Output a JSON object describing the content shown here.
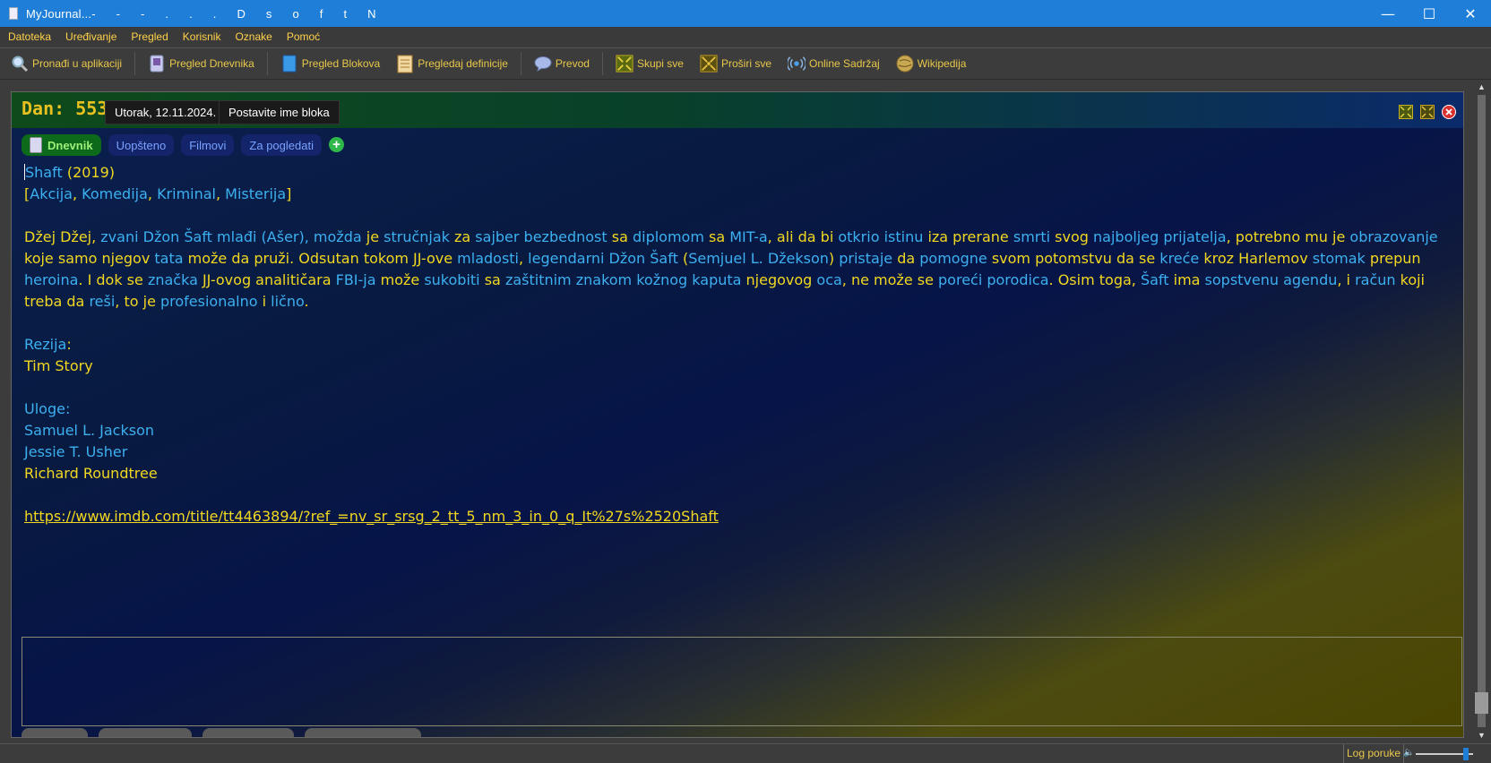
{
  "window": {
    "title": "MyJournal...-      -      -      .      .      .      D      s      o      f      t      N",
    "minimize_glyph": "—",
    "maximize_glyph": "☐",
    "close_glyph": "✕"
  },
  "menu": [
    "Datoteka",
    "Uređivanje",
    "Pregled",
    "Korisnik",
    "Oznake",
    "Pomoć"
  ],
  "toolbar": {
    "find": "Pronađi u aplikaciji",
    "journal": "Pregled Dnevnika",
    "blocks": "Pregled Blokova",
    "definitions": "Pregledaj definicije",
    "translate": "Prevod",
    "collapse": "Skupi sve",
    "expand": "Proširi sve",
    "online": "Online Sadržaj",
    "wiki": "Wikipedija"
  },
  "panel": {
    "day": "Dan: 553",
    "date": "Utorak, 12.11.2024.",
    "block_name_button": "Postavite ime bloka"
  },
  "tabs": {
    "journal": "Dnevnik",
    "general": "Uopšteno",
    "movies": "Filmovi",
    "watchlist": "Za pogledati",
    "add": "+"
  },
  "entry": {
    "title_word": "Shaft",
    "year": "(2019)",
    "genres_open": "[",
    "genre1": "Akcija",
    "genre2": "Komedija",
    "genre3": "Kriminal",
    "genre4": "Misterija",
    "genres_close": "]",
    "comma": ", ",
    "description_parts": [
      [
        "y",
        "Džej Džej, "
      ],
      [
        "b",
        "zvani Džon Šaft mlađi (Ašer), "
      ],
      [
        "b",
        "možda "
      ],
      [
        "y",
        "je "
      ],
      [
        "b",
        "stručnjak "
      ],
      [
        "y",
        "za "
      ],
      [
        "b",
        "sajber bezbednost "
      ],
      [
        "y",
        "sa "
      ],
      [
        "b",
        "diplomom "
      ],
      [
        "y",
        "sa "
      ],
      [
        "b",
        "MIT-a"
      ],
      [
        "y",
        ", ali da bi "
      ],
      [
        "b",
        "otkrio istinu "
      ],
      [
        "y",
        "iza prerane "
      ],
      [
        "b",
        "smrti "
      ],
      [
        "y",
        "svog "
      ],
      [
        "b",
        "najboljeg prijatelja"
      ],
      [
        "y",
        ", potrebno mu je "
      ],
      [
        "b",
        "obrazovanje "
      ],
      [
        "y",
        "koje samo njegov "
      ],
      [
        "b",
        "tata "
      ],
      [
        "y",
        "može da pruži. Odsutan tokom JJ-ove "
      ],
      [
        "b",
        "mladosti"
      ],
      [
        "y",
        ", "
      ],
      [
        "b",
        "legendarni Džon Šaft "
      ],
      [
        "y",
        "("
      ],
      [
        "b",
        "Semjuel L. Džekson"
      ],
      [
        "y",
        ") "
      ],
      [
        "b",
        "pristaje "
      ],
      [
        "y",
        "da "
      ],
      [
        "b",
        "pomogne "
      ],
      [
        "y",
        "svom potomstvu da se "
      ],
      [
        "b",
        "kreće "
      ],
      [
        "y",
        "kroz Harlemov "
      ],
      [
        "b",
        "stomak "
      ],
      [
        "y",
        "prepun "
      ],
      [
        "b",
        "heroina"
      ],
      [
        "y",
        ". I dok se "
      ],
      [
        "b",
        "značka "
      ],
      [
        "y",
        "JJ-ovog analitičara "
      ],
      [
        "b",
        "FBI-ja "
      ],
      [
        "y",
        "može "
      ],
      [
        "b",
        "sukobiti "
      ],
      [
        "y",
        "sa "
      ],
      [
        "b",
        "zaštitnim znakom kožnog kaputa "
      ],
      [
        "y",
        "njegovog "
      ],
      [
        "b",
        "oca"
      ],
      [
        "y",
        ", ne može se "
      ],
      [
        "b",
        "poreći porodica"
      ],
      [
        "y",
        ". Osim toga, "
      ],
      [
        "b",
        "Šaft "
      ],
      [
        "y",
        "ima "
      ],
      [
        "b",
        "sopstvenu "
      ],
      [
        "b",
        "agendu"
      ],
      [
        "y",
        ", i "
      ],
      [
        "b",
        "račun "
      ],
      [
        "y",
        "koji treba da "
      ],
      [
        "b",
        "reši"
      ],
      [
        "y",
        ", to je "
      ],
      [
        "b",
        "profesionalno "
      ],
      [
        "y",
        "i "
      ],
      [
        "b",
        "lično"
      ],
      [
        "y",
        "."
      ]
    ],
    "director_label": "Rezija",
    "director": "Tim Story",
    "cast_label": "Uloge:",
    "cast1": "Samuel L. Jackson",
    "cast2": "Jessie T. Usher",
    "cast3": "Richard Roundtree",
    "url": "https://www.imdb.com/title/tt4463894/?ref_=nv_sr_srsg_2_tt_5_nm_3_in_0_q_It%27s%2520Shaft"
  },
  "statusbar": {
    "log": "Log poruke",
    "volume_level": 0.88
  }
}
